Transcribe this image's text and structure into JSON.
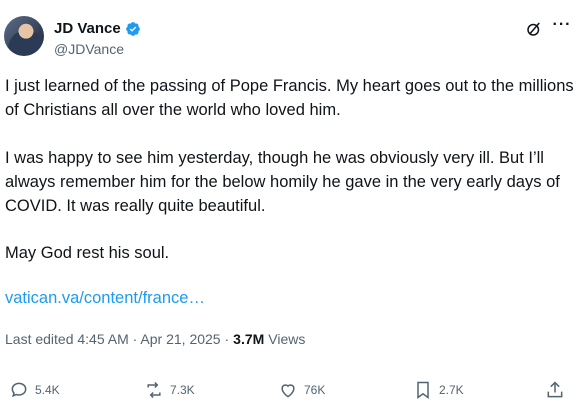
{
  "author": {
    "name": "JD Vance",
    "handle": "@JDVance"
  },
  "post": {
    "paragraph1": "I just learned of the passing of Pope Francis. My heart goes out to the millions of Christians all over the world who loved him.",
    "paragraph2": "I was happy to see him yesterday, though he was obviously very ill. But I’ll always remember him for the below homily he gave in the very early days of COVID. It was really quite beautiful.",
    "paragraph3": "May God rest his soul.",
    "link": "vatican.va/content/france…"
  },
  "meta": {
    "edited": "Last edited 4:45 AM · Apr 21, 2025 ·",
    "views_count": "3.7M",
    "views_label": "Views"
  },
  "actions": {
    "replies": "5.4K",
    "reposts": "7.3K",
    "likes": "76K",
    "bookmarks": "2.7K"
  },
  "colors": {
    "link": "#1d9bf0",
    "verified": "#1d9bf0",
    "secondary": "#536471"
  },
  "icons": [
    "verified-badge-icon",
    "grok-icon",
    "more-icon",
    "reply-icon",
    "repost-icon",
    "like-icon",
    "bookmark-icon",
    "share-icon"
  ]
}
